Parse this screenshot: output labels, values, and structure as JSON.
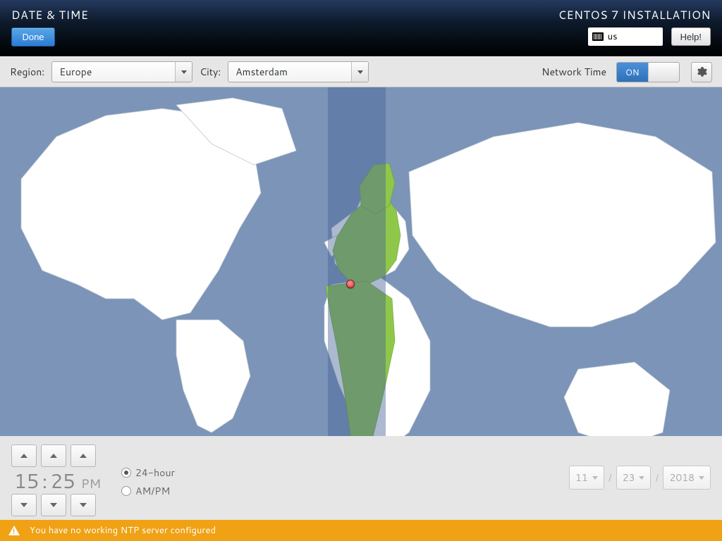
{
  "header": {
    "title": "DATE & TIME",
    "done": "Done",
    "install_title": "CENTOS 7 INSTALLATION",
    "keyboard_layout": "us",
    "help": "Help!"
  },
  "filter": {
    "region_label": "Region:",
    "region_value": "Europe",
    "city_label": "City:",
    "city_value": "Amsterdam",
    "network_time_label": "Network Time",
    "network_time_state": "ON"
  },
  "time": {
    "hours": "15",
    "sep": ":",
    "minutes": "25",
    "ampm": "PM",
    "format_24": "24-hour",
    "format_ampm": "AM/PM",
    "selected_format": "24-hour"
  },
  "date": {
    "month": "11",
    "day": "23",
    "year": "2018",
    "sep": "/"
  },
  "warning": {
    "message": "You have no working NTP server configured"
  }
}
